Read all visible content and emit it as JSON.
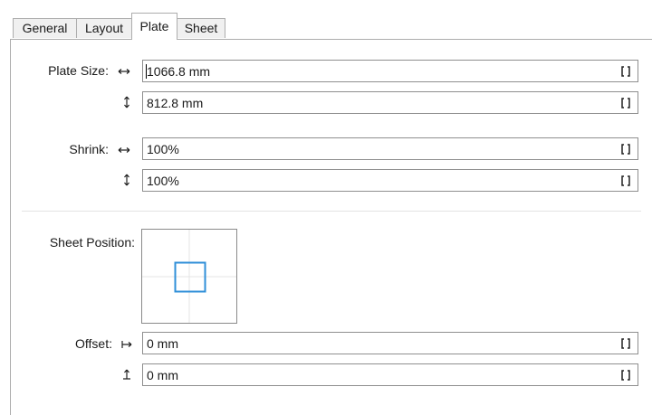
{
  "tabs": [
    {
      "label": "General",
      "active": false
    },
    {
      "label": "Layout",
      "active": false
    },
    {
      "label": "Plate",
      "active": true
    },
    {
      "label": "Sheet",
      "active": false
    }
  ],
  "plate_size": {
    "label": "Plate Size:",
    "width_value": "1066.8 mm",
    "height_value": "812.8 mm"
  },
  "shrink": {
    "label": "Shrink:",
    "horizontal_value": "100%",
    "vertical_value": "100%"
  },
  "sheet_position": {
    "label": "Sheet Position:",
    "accent_color": "#2f8fd8"
  },
  "offset": {
    "label": "Offset:",
    "horizontal_value": "0 mm",
    "vertical_value": "0 mm"
  },
  "icons": {
    "horizontal": "horizontal-arrow-icon",
    "vertical": "vertical-arrow-icon",
    "offset_horizontal": "offset-right-icon",
    "offset_vertical": "offset-up-icon",
    "lock": "bracket-lock-icon"
  }
}
